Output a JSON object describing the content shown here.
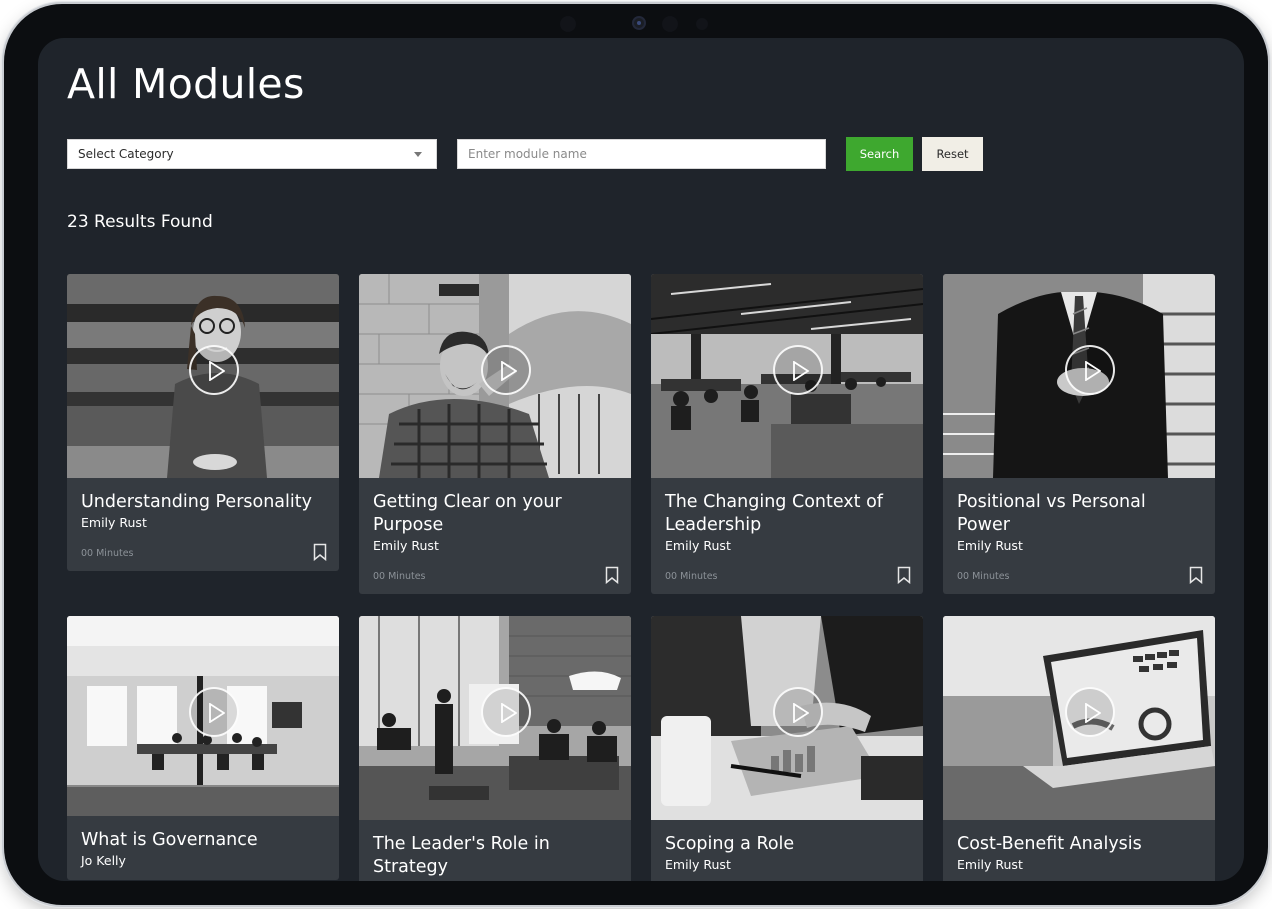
{
  "page": {
    "title": "All Modules",
    "results_text": "23 Results Found"
  },
  "filters": {
    "category_selected": "Select Category",
    "search_placeholder": "Enter module name",
    "search_label": "Search",
    "reset_label": "Reset"
  },
  "modules": [
    {
      "title": "Understanding Personality",
      "author": "Emily Rust",
      "duration": "00 Minutes",
      "image": "portrait-woman-glasses"
    },
    {
      "title": "Getting Clear on your Purpose",
      "author": "Emily Rust",
      "duration": "00 Minutes",
      "image": "man-thinking-cafe"
    },
    {
      "title": "The Changing Context of Leadership",
      "author": "Emily Rust",
      "duration": "00 Minutes",
      "image": "open-plan-office"
    },
    {
      "title": "Positional vs Personal Power",
      "author": "Emily Rust",
      "duration": "00 Minutes",
      "image": "businessman-suit"
    },
    {
      "title": "What is Governance",
      "author": "Jo Kelly",
      "duration": "",
      "image": "glass-meeting-room"
    },
    {
      "title": "The Leader's Role in Strategy",
      "author": "",
      "duration": "",
      "image": "team-presentation"
    },
    {
      "title": "Scoping a Role",
      "author": "Emily Rust",
      "duration": "",
      "image": "tablet-documents"
    },
    {
      "title": "Cost-Benefit Analysis",
      "author": "Emily Rust",
      "duration": "",
      "image": "laptop-dashboard"
    }
  ],
  "colors": {
    "screen_bg": "#1f242b",
    "card_bg": "#363b41",
    "search_button": "#3ea82f",
    "reset_button": "#f1eee6"
  },
  "icons": {
    "play": "play-icon",
    "bookmark": "bookmark-icon",
    "dropdown": "chevron-down-icon"
  }
}
